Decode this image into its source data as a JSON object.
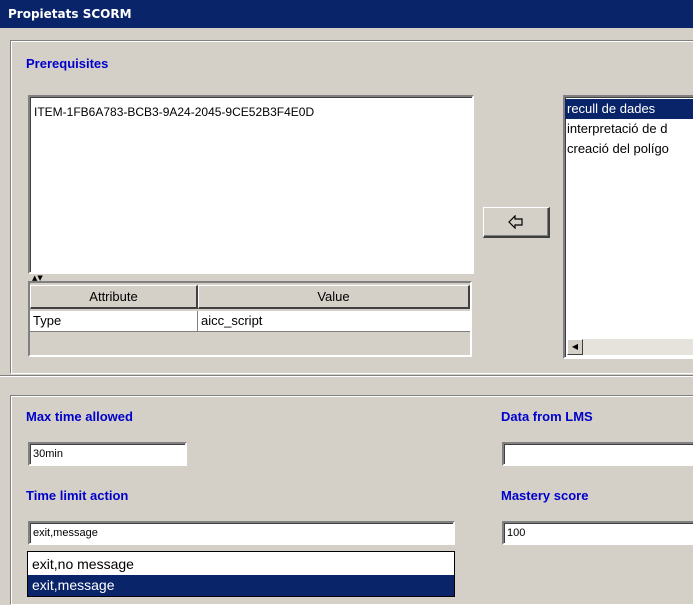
{
  "window": {
    "title": "Propietats SCORM"
  },
  "prerequisites": {
    "heading": "Prerequisites",
    "text": "ITEM-1FB6A783-BCB3-9A24-2045-9CE52B3F4E0D",
    "table": {
      "columns": [
        "Attribute",
        "Value"
      ],
      "rows": [
        {
          "attribute": "Type",
          "value": "aicc_script"
        }
      ]
    },
    "add_button_icon": "arrow-left-icon",
    "items": [
      "recull de dades",
      "interpretació de d",
      "creació del polígo"
    ],
    "selected_index": 0
  },
  "fields": {
    "max_time": {
      "label": "Max time allowed",
      "value": "30min"
    },
    "data_from_lms": {
      "label": "Data from LMS",
      "value": ""
    },
    "time_limit_action": {
      "label": "Time limit action",
      "value": "exit,message",
      "options": [
        "exit,no message",
        "exit,message"
      ],
      "selected_index": 1
    },
    "mastery_score": {
      "label": "Mastery score",
      "value": "100"
    }
  },
  "colors": {
    "title_bar": "#0a246a",
    "heading": "#0000cc",
    "background": "#d4d0c8",
    "selection": "#0a246a"
  }
}
